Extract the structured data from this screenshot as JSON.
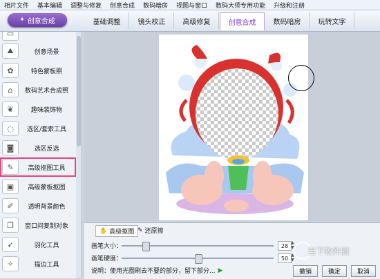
{
  "menu": [
    "相片文件",
    "基本编辑",
    "调整与修复",
    "创意合成",
    "数码暗房",
    "视图与窗口",
    "数码大师专用功能",
    "升级和注册"
  ],
  "toolbar": {
    "create_btn": "创意合成"
  },
  "tabs": [
    {
      "label": "基础调整",
      "active": false
    },
    {
      "label": "镜头校正",
      "active": false
    },
    {
      "label": "高级修复",
      "active": false
    },
    {
      "label": "创意合成",
      "active": true
    },
    {
      "label": "数码暗房",
      "active": false
    },
    {
      "label": "玩转文字",
      "active": false
    }
  ],
  "sidebar": {
    "items": [
      {
        "label": "创意场景",
        "icon": "landscape-icon"
      },
      {
        "label": "特色蒙板照",
        "icon": "flower-icon"
      },
      {
        "label": "数码艺术合成照",
        "icon": "frame-icon"
      },
      {
        "label": "趣味装饰物",
        "icon": "bow-icon"
      },
      {
        "label": "选区/套索工具",
        "icon": "lasso-icon"
      },
      {
        "label": "选区反选",
        "icon": "invert-selection-icon"
      },
      {
        "label": "高级抠图工具",
        "icon": "brush-icon",
        "highlight": true
      },
      {
        "label": "高级蒙板抠图",
        "icon": "mask-icon"
      },
      {
        "label": "透明背景颜色",
        "icon": "pen-icon"
      },
      {
        "label": "窗口间复制对象",
        "icon": "copy-window-icon"
      },
      {
        "label": "羽化工具",
        "icon": "feather-icon"
      },
      {
        "label": "描边工具",
        "icon": "star-icon"
      }
    ]
  },
  "panel": {
    "tabs": [
      {
        "label": "高级抠图",
        "active": true
      },
      {
        "label": "还原擦",
        "active": false
      }
    ],
    "brush_size": {
      "label": "画笔大小：",
      "value": "28",
      "position": 0.08
    },
    "brush_hardness": {
      "label": "画笔硬度：",
      "value": "50",
      "position": 0.5
    },
    "hint": "说明：使用光圈刷去不要的部分，留下部分...",
    "buttons": {
      "cancel": "撤销",
      "ok": "确定",
      "close": "取消"
    }
  },
  "watermark": "当下软件园",
  "colors": {
    "accent": "#8a3fd0",
    "highlight": "#e8457a"
  }
}
